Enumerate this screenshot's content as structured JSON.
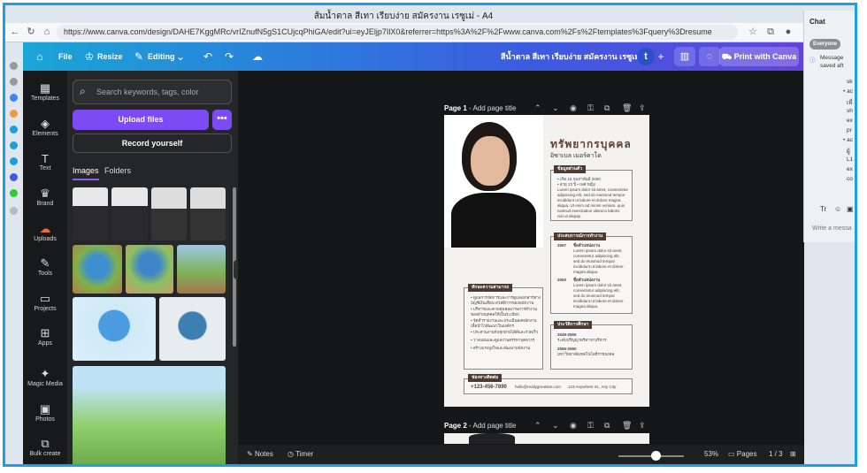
{
  "browser": {
    "tab_title": "ส้มน้ำตาล สีเทา เรียบง่าย สมัครงาน เรซูเม่ - A4",
    "url": "https://www.canva.com/design/DAHE7KggMRc/vrIZnufN5gS1CUjcqPhiGA/edit?ui=eyJEljp7IlX0&referrer=https%3A%2F%2Fwww.canva.com%2Fs%2Ftemplates%3Fquery%3Dresume"
  },
  "toolbar": {
    "file": "File",
    "resize": "Resize",
    "editing": "Editing",
    "doc_title": "สีน้ำตาล สีเทา เรียบง่าย สมัครงาน เรซูเม่",
    "avatar_letter": "t",
    "print": "Print with Canva"
  },
  "rail": [
    {
      "label": "Templates",
      "icon": "templates-icon",
      "glyph": "▦"
    },
    {
      "label": "Elements",
      "icon": "elements-icon",
      "glyph": "◈"
    },
    {
      "label": "Text",
      "icon": "text-icon",
      "glyph": "T"
    },
    {
      "label": "Brand",
      "icon": "brand-icon",
      "glyph": "♛"
    },
    {
      "label": "Uploads",
      "icon": "uploads-icon",
      "glyph": "☁"
    },
    {
      "label": "Tools",
      "icon": "tools-icon",
      "glyph": "✎"
    },
    {
      "label": "Projects",
      "icon": "projects-icon",
      "glyph": "▭"
    },
    {
      "label": "Apps",
      "icon": "apps-icon",
      "glyph": "⊞"
    },
    {
      "label": "Magic Media",
      "icon": "magic-media-icon",
      "glyph": "✦"
    },
    {
      "label": "Photos",
      "icon": "photos-icon",
      "glyph": "▣"
    },
    {
      "label": "Bulk create",
      "icon": "bulk-create-icon",
      "glyph": "⧉"
    }
  ],
  "panel": {
    "search_placeholder": "Search keywords, tags, color",
    "upload_button": "Upload files",
    "more_button": "•••",
    "record_button": "Record yourself",
    "tabs": [
      "Images",
      "Folders"
    ]
  },
  "canvas": {
    "page1_label": "Page 1",
    "page2_label": "Page 2",
    "add_title": "Add page title"
  },
  "resume": {
    "name": "ทรัพยากรบุคคล",
    "subtitle": "อิซาเบล เมอร์คาโด",
    "personal_header": "ข้อมูลส่วนตัว",
    "personal_lines": [
      "• เกิด 16 กุมภาพันธ์ 2000",
      "• อายุ 23 ปี • เพศ หญิง",
      "Lorem ipsum dolor sit amet, consectetur",
      "adipiscing elit, sed do eiusmod tempor",
      "incididunt ut labore et dolore magna",
      "aliqua. Ut enim ad minim veniam, quis",
      "nostrud exercitation ullamco laboris",
      "nisi ut aliquip."
    ],
    "experience_header": "ประสบการณ์การทำงาน",
    "exp1_year": "2557",
    "exp1_title": "ชื่อตำแหน่งงาน",
    "exp2_year": "2550",
    "exp2_title": "ชื่อตำแหน่งงาน",
    "exp_lines": [
      "Lorem ipsum dolor sit amet,",
      "consectetur adipiscing elit,",
      "sed do eiusmod tempor",
      "incididunt ut labore et dolore",
      "magna aliqua."
    ],
    "skills_header": "ทักษะความสามารถ",
    "skills_lines": [
      "• ดูแลการจัดการและการดูแลเอกสารทาง",
      "  บัญชีเงินเดือน สวัสดิการของพนักงาน",
      "• บริหารและควบคุมคุณภาพการทำงาน",
      "  ของฝ่ายบุคคลให้เป็นระเบียบ",
      "• จัดทำรายงานและประเมินผลพนักงาน",
      "  เพื่อนำไปพัฒนาในองค์กร",
      "• ประสานงานกับทุกฝ่ายได้ดีและรวดเร็ว",
      "• วางแผนและดูแลงานสรรหาบุคลากร",
      "• สร้างแรงจูงใจและพัฒนาพนักงาน"
    ],
    "education_header": "ประวัติการศึกษา",
    "edu1_years": "2549-2555",
    "edu1_text": "ระดับปริญญาตรีสาขาบริหาร",
    "edu2_years": "2555-2560",
    "edu2_text": "มหาวิทยาลัยเทคโนโลยีราชมงคล",
    "contact_header": "ช่องทางติดต่อ",
    "phone": "+123-456-7890",
    "email": "hello@reallygreatsite.com",
    "address": "123 Anywhere St., Any City"
  },
  "bottom": {
    "notes": "Notes",
    "timer": "Timer",
    "zoom": "53%",
    "pages": "Pages",
    "page_count": "1 / 3"
  },
  "chat": {
    "title": "Chat",
    "filter": "Everyone",
    "messages": [
      "Message",
      "saved aft"
    ],
    "fragments": [
      "sk",
      "• ac",
      "เพื่",
      "sh",
      "ex",
      "pr",
      "• ac",
      "ผู้",
      "L1",
      "ex",
      "co"
    ],
    "input_placeholder": "Write a messa"
  },
  "colors": {
    "accent": "#7d4bf3",
    "resume_brown": "#4a3a33"
  }
}
